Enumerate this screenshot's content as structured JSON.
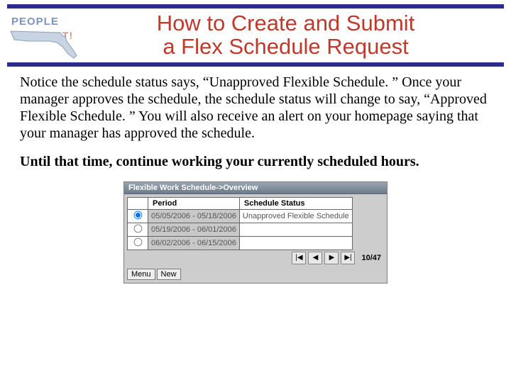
{
  "logo": {
    "primary": "PEOPLE",
    "secondary": "FIRST!"
  },
  "title": {
    "line1": "How to Create and Submit",
    "line2": "a Flex Schedule Request"
  },
  "body": {
    "p1": "Notice the schedule status says, “Unapproved Flexible Schedule. ” Once your manager approves the schedule, the schedule status will change to say, “Approved Flexible Schedule. ”  You will also receive an alert on your homepage saying that your manager has approved the schedule.",
    "p2": "Until that time, continue working your currently scheduled hours."
  },
  "widget": {
    "title": "Flexible Work Schedule->Overview",
    "columns": {
      "period": "Period",
      "status": "Schedule Status"
    },
    "rows": [
      {
        "selected": true,
        "period": "05/05/2006 - 05/18/2006",
        "status": "Unapproved Flexible Schedule"
      },
      {
        "selected": false,
        "period": "05/19/2006 - 06/01/2006",
        "status": ""
      },
      {
        "selected": false,
        "period": "06/02/2006 - 06/15/2006",
        "status": ""
      }
    ],
    "pager": {
      "first": "|◀",
      "prev": "◀",
      "next": "▶",
      "last": "▶|",
      "count": "10/47"
    },
    "buttons": {
      "menu": "Menu",
      "new": "New"
    }
  }
}
